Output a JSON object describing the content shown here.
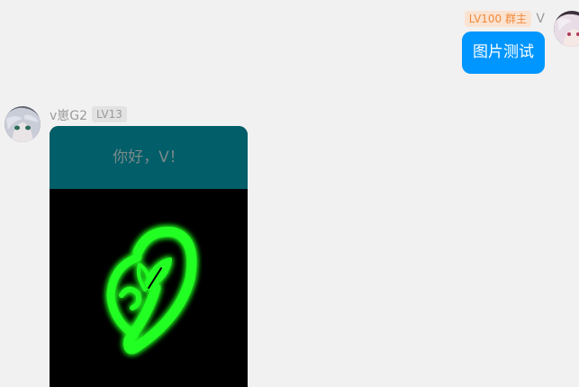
{
  "me": {
    "level_badge": "LV100 群主",
    "name": "V",
    "message": "图片测试"
  },
  "peer": {
    "name": "v崽G2",
    "level_badge": "LV13",
    "image_header_text": "你好，V！"
  },
  "colors": {
    "page_bg": "#f2f1f1",
    "bubble_blue": "#0096ff",
    "owner_badge_bg": "#fbe3d2",
    "owner_badge_text": "#f08a3b",
    "level_badge_bg": "#e2e2e2",
    "image_header_bg": "#025e69",
    "emblem_green": "#22ff22"
  }
}
